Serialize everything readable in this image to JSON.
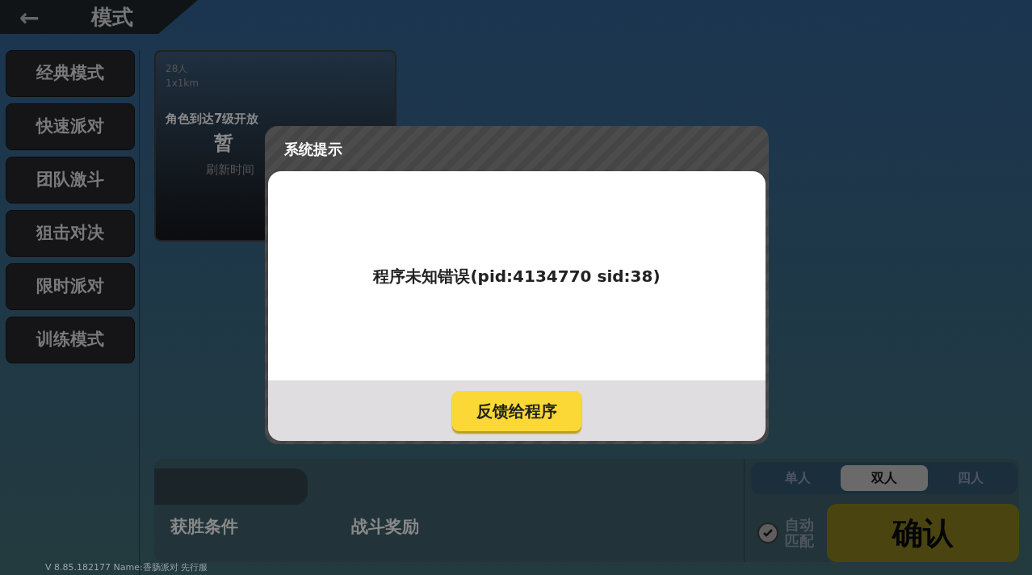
{
  "header": {
    "back": "←",
    "title": "模式"
  },
  "modes": [
    {
      "label": "经典模式"
    },
    {
      "label": "快速派对"
    },
    {
      "label": "团队激斗"
    },
    {
      "label": "狙击对决"
    },
    {
      "label": "限时派对"
    },
    {
      "label": "训练模式"
    }
  ],
  "map_card": {
    "players": "28人",
    "size": "1x1km",
    "lock_text": "角色到达7级开放",
    "status": "暂",
    "refresh": "刷新时间"
  },
  "info_panel": {
    "tabs": [
      "获胜条件",
      "战斗奖励"
    ]
  },
  "team_size": [
    {
      "label": "单人",
      "selected": false
    },
    {
      "label": "双人",
      "selected": true
    },
    {
      "label": "四人",
      "selected": false
    }
  ],
  "auto_match": {
    "label": "自动匹配",
    "checked": true
  },
  "confirm": "确认",
  "version": "V 8.85.182177 Name:香肠派对 先行服",
  "dialog": {
    "title": "系统提示",
    "message": "程序未知错误(pid:4134770 sid:38)",
    "button": "反馈给程序"
  }
}
